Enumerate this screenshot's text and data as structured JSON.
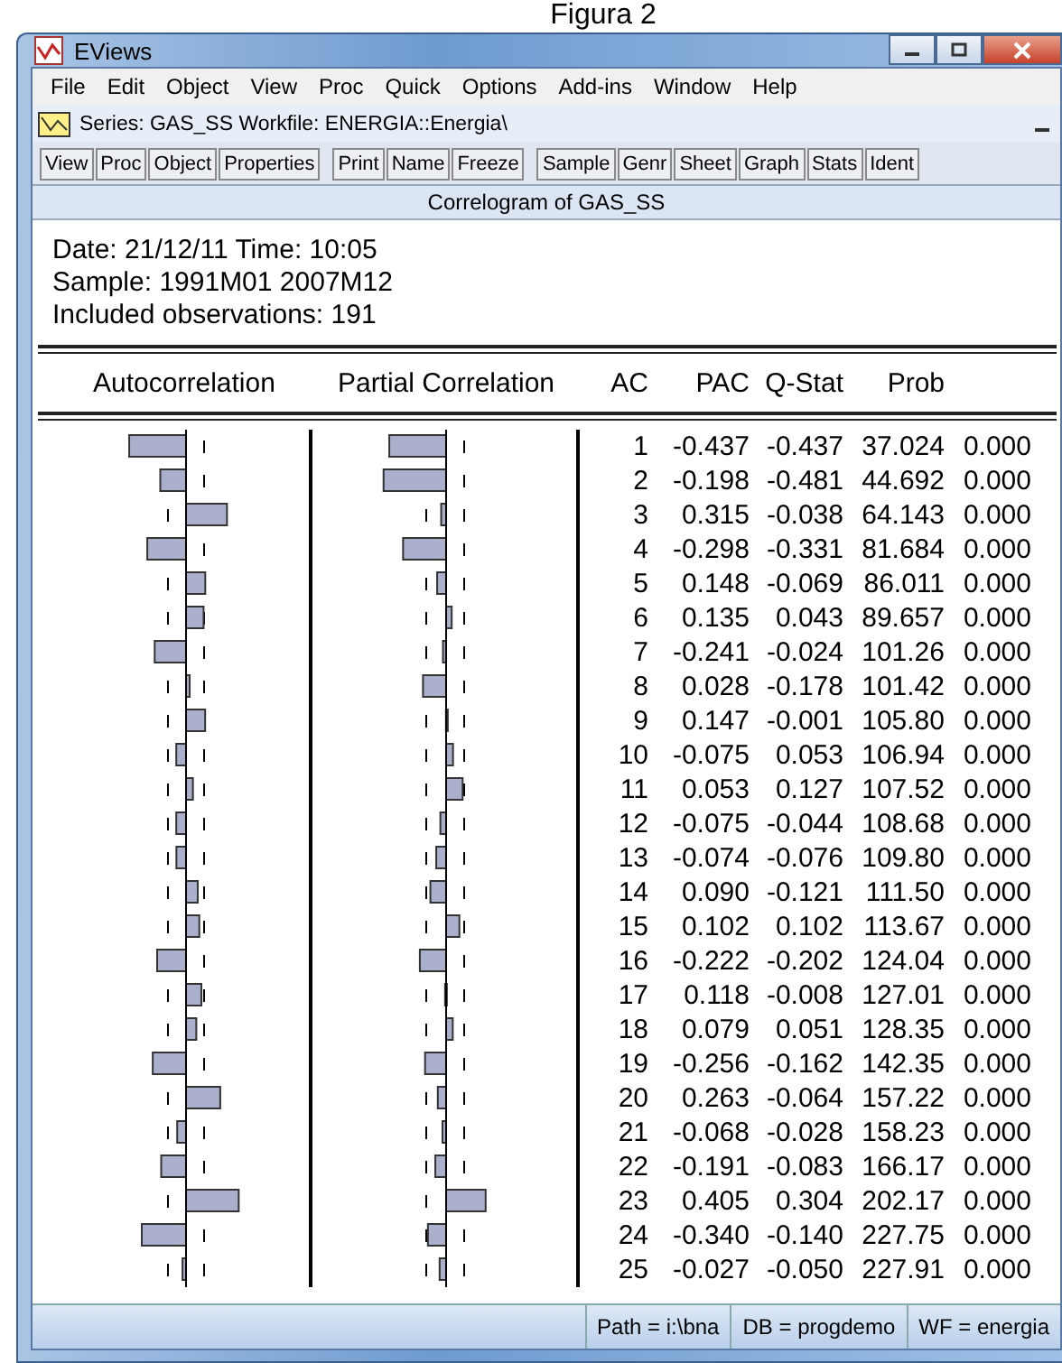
{
  "caption": "Figura 2",
  "window": {
    "title": "EViews"
  },
  "menu": [
    "File",
    "Edit",
    "Object",
    "View",
    "Proc",
    "Quick",
    "Options",
    "Add-ins",
    "Window",
    "Help"
  ],
  "document": {
    "title": "Series: GAS_SS   Workfile: ENERGIA::Energia\\"
  },
  "toolbar": [
    [
      "View",
      "Proc",
      "Object",
      "Properties"
    ],
    [
      "Print",
      "Name",
      "Freeze"
    ],
    [
      "Sample",
      "Genr",
      "Sheet",
      "Graph",
      "Stats",
      "Ident"
    ]
  ],
  "view_title": "Correlogram of GAS_SS",
  "info": [
    "Date: 21/12/11   Time: 10:05",
    "Sample: 1991M01 2007M12",
    "Included observations: 191"
  ],
  "columns": [
    "Autocorrelation",
    "Partial Correlation",
    "AC",
    "PAC",
    "Q-Stat",
    "Prob"
  ],
  "rows": [
    {
      "lag": "1",
      "ac": "-0.437",
      "pac": "-0.437",
      "q": "37.024",
      "prob": "0.000"
    },
    {
      "lag": "2",
      "ac": "-0.198",
      "pac": "-0.481",
      "q": "44.692",
      "prob": "0.000"
    },
    {
      "lag": "3",
      "ac": "0.315",
      "pac": "-0.038",
      "q": "64.143",
      "prob": "0.000"
    },
    {
      "lag": "4",
      "ac": "-0.298",
      "pac": "-0.331",
      "q": "81.684",
      "prob": "0.000"
    },
    {
      "lag": "5",
      "ac": "0.148",
      "pac": "-0.069",
      "q": "86.011",
      "prob": "0.000"
    },
    {
      "lag": "6",
      "ac": "0.135",
      "pac": "0.043",
      "q": "89.657",
      "prob": "0.000"
    },
    {
      "lag": "7",
      "ac": "-0.241",
      "pac": "-0.024",
      "q": "101.26",
      "prob": "0.000"
    },
    {
      "lag": "8",
      "ac": "0.028",
      "pac": "-0.178",
      "q": "101.42",
      "prob": "0.000"
    },
    {
      "lag": "9",
      "ac": "0.147",
      "pac": "-0.001",
      "q": "105.80",
      "prob": "0.000"
    },
    {
      "lag": "10",
      "ac": "-0.075",
      "pac": "0.053",
      "q": "106.94",
      "prob": "0.000"
    },
    {
      "lag": "11",
      "ac": "0.053",
      "pac": "0.127",
      "q": "107.52",
      "prob": "0.000"
    },
    {
      "lag": "12",
      "ac": "-0.075",
      "pac": "-0.044",
      "q": "108.68",
      "prob": "0.000"
    },
    {
      "lag": "13",
      "ac": "-0.074",
      "pac": "-0.076",
      "q": "109.80",
      "prob": "0.000"
    },
    {
      "lag": "14",
      "ac": "0.090",
      "pac": "-0.121",
      "q": "111.50",
      "prob": "0.000"
    },
    {
      "lag": "15",
      "ac": "0.102",
      "pac": "0.102",
      "q": "113.67",
      "prob": "0.000"
    },
    {
      "lag": "16",
      "ac": "-0.222",
      "pac": "-0.202",
      "q": "124.04",
      "prob": "0.000"
    },
    {
      "lag": "17",
      "ac": "0.118",
      "pac": "-0.008",
      "q": "127.01",
      "prob": "0.000"
    },
    {
      "lag": "18",
      "ac": "0.079",
      "pac": "0.051",
      "q": "128.35",
      "prob": "0.000"
    },
    {
      "lag": "19",
      "ac": "-0.256",
      "pac": "-0.162",
      "q": "142.35",
      "prob": "0.000"
    },
    {
      "lag": "20",
      "ac": "0.263",
      "pac": "-0.064",
      "q": "157.22",
      "prob": "0.000"
    },
    {
      "lag": "21",
      "ac": "-0.068",
      "pac": "-0.028",
      "q": "158.23",
      "prob": "0.000"
    },
    {
      "lag": "22",
      "ac": "-0.191",
      "pac": "-0.083",
      "q": "166.17",
      "prob": "0.000"
    },
    {
      "lag": "23",
      "ac": "0.405",
      "pac": "0.304",
      "q": "202.17",
      "prob": "0.000"
    },
    {
      "lag": "24",
      "ac": "-0.340",
      "pac": "-0.140",
      "q": "227.75",
      "prob": "0.000"
    },
    {
      "lag": "25",
      "ac": "-0.027",
      "pac": "-0.050",
      "q": "227.91",
      "prob": "0.000"
    }
  ],
  "status_bar": [
    "Path = i:\\bna",
    "DB = progdemo",
    "WF = energia"
  ]
}
